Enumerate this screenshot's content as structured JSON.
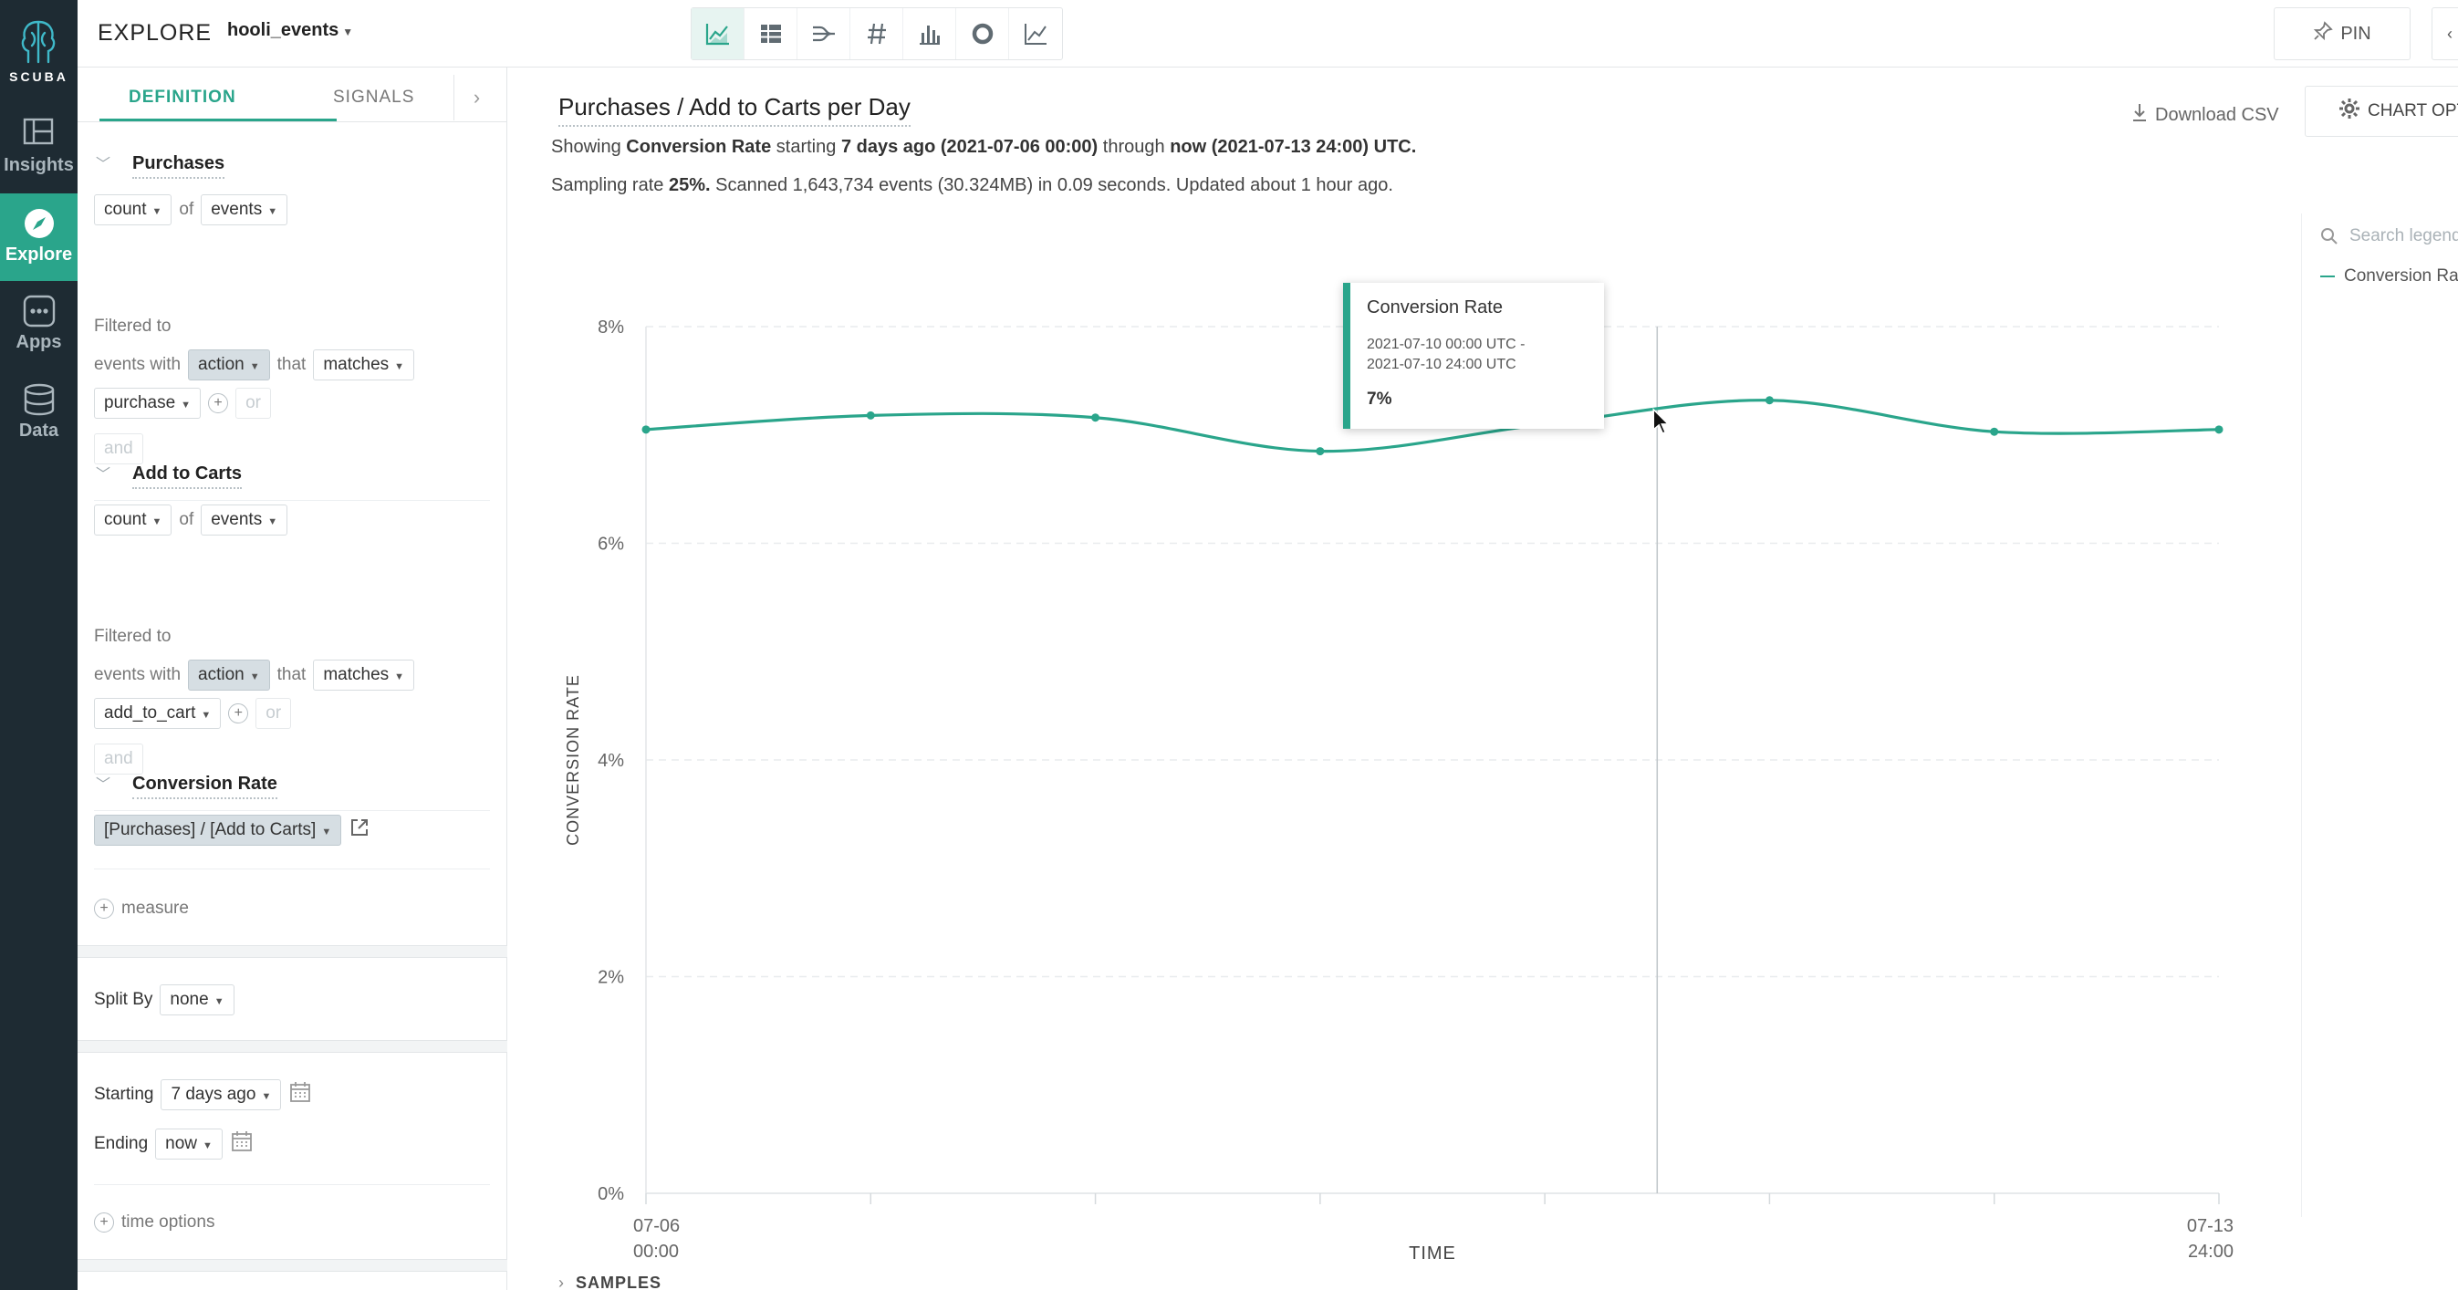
{
  "nav": {
    "logo_text": "SCUBA",
    "items": [
      {
        "label": "Insights",
        "icon": "insights-icon"
      },
      {
        "label": "Explore",
        "icon": "compass-icon",
        "active": true
      },
      {
        "label": "Apps",
        "icon": "apps-grid-icon"
      },
      {
        "label": "Data",
        "icon": "database-icon"
      }
    ]
  },
  "topbar": {
    "title": "EXPLORE",
    "dataset": "hooli_events",
    "view_icons": [
      "line-chart-icon",
      "table-icon",
      "flow-icon",
      "number-icon",
      "bar-chart-icon",
      "donut-icon",
      "trend-icon"
    ],
    "pin_label": "PIN"
  },
  "sidebar": {
    "tab_definition": "DEFINITION",
    "tab_signals": "SIGNALS",
    "filtered_to": "Filtered to",
    "events_with": "events with",
    "that": "that",
    "of": "of",
    "or": "or",
    "and": "and",
    "measures": [
      {
        "name": "Purchases",
        "agg": "count",
        "target": "events",
        "field": "action",
        "op": "matches",
        "value": "purchase"
      },
      {
        "name": "Add to Carts",
        "agg": "count",
        "target": "events",
        "field": "action",
        "op": "matches",
        "value": "add_to_cart"
      }
    ],
    "formula": {
      "name": "Conversion Rate",
      "expr": "[Purchases] / [Add to Carts]"
    },
    "add_measure": "measure",
    "split_by_label": "Split By",
    "split_by_value": "none",
    "starting_label": "Starting",
    "starting_value": "7 days ago",
    "ending_label": "Ending",
    "ending_value": "now",
    "time_options": "time options"
  },
  "main": {
    "title": "Purchases / Add to Carts per Day",
    "info1": {
      "showing": "Showing",
      "metric": "Conversion Rate",
      "starting": "starting",
      "start": "7 days ago (2021-07-06 00:00)",
      "through": "through",
      "end": "now (2021-07-13 24:00) UTC."
    },
    "info2": {
      "sampling": "Sampling rate",
      "rate": "25%.",
      "rest": "Scanned 1,643,734 events (30.324MB) in 0.09 seconds. Updated about 1 hour ago."
    },
    "download_csv": "Download CSV",
    "chart_options": "CHART OPTIONS",
    "legend_search_placeholder": "Search legend",
    "legend_entry": "Conversion Rate",
    "samples": "SAMPLES"
  },
  "tooltip": {
    "title": "Conversion Rate",
    "range_start": "2021-07-10 00:00 UTC -",
    "range_end": "2021-07-10 24:00 UTC",
    "value": "7%"
  },
  "chart_data": {
    "type": "line",
    "xlabel": "TIME",
    "ylabel": "CONVERSION RATE",
    "y_ticks": [
      "0%",
      "2%",
      "4%",
      "6%",
      "8%"
    ],
    "ylim": [
      0,
      8
    ],
    "x_tick_labels": [
      {
        "top": "07-06",
        "bottom": "00:00"
      },
      {
        "top": "07-13",
        "bottom": "24:00"
      }
    ],
    "series": [
      {
        "name": "Conversion Rate",
        "color": "#2aa58b",
        "x": [
          "07-06",
          "07-07",
          "07-08",
          "07-09",
          "07-10",
          "07-11",
          "07-12",
          "07-13"
        ],
        "values": [
          7.05,
          7.18,
          7.16,
          6.85,
          7.1,
          7.32,
          7.03,
          7.05
        ]
      }
    ],
    "grid": true,
    "hover_index": 4
  }
}
